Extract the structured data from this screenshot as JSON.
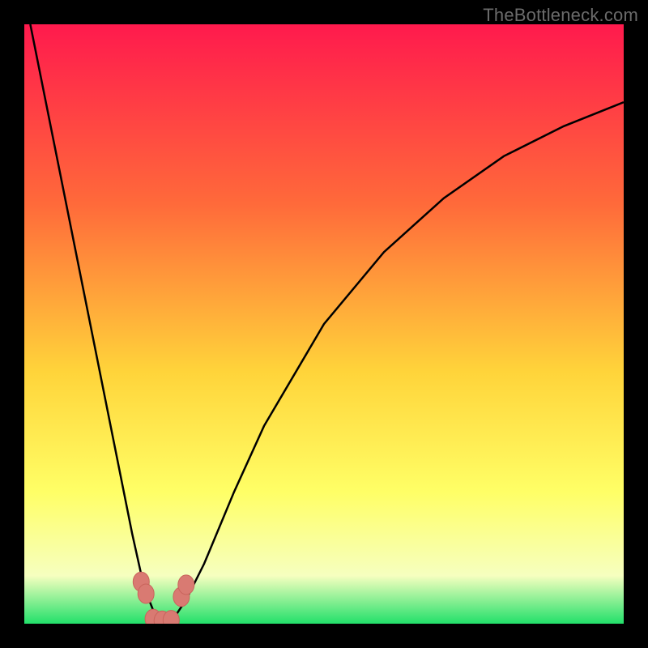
{
  "watermark": "TheBottleneck.com",
  "colors": {
    "frame": "#000000",
    "grad_top": "#ff1a4d",
    "grad_mid1": "#ff6a3a",
    "grad_mid2": "#ffd43a",
    "grad_mid3": "#ffff66",
    "grad_mid4": "#f6ffbf",
    "grad_bottom": "#22e06a",
    "curve": "#000000",
    "marker_fill": "#d97a72",
    "marker_stroke": "#c9645c"
  },
  "chart_data": {
    "type": "line",
    "title": "",
    "xlabel": "",
    "ylabel": "",
    "xlim": [
      0,
      100
    ],
    "ylim": [
      0,
      100
    ],
    "note": "V-shaped bottleneck curve, minimum ~0 near x≈23; watermark TheBottleneck.com",
    "series": [
      {
        "name": "bottleneck-curve",
        "x": [
          1,
          5,
          10,
          15,
          18,
          20,
          22,
          23,
          25,
          27,
          30,
          35,
          40,
          50,
          60,
          70,
          80,
          90,
          100
        ],
        "y": [
          100,
          80,
          55,
          30,
          15,
          6,
          1,
          0,
          1,
          4,
          10,
          22,
          33,
          50,
          62,
          71,
          78,
          83,
          87
        ]
      }
    ],
    "markers": [
      {
        "x": 19.5,
        "y": 7
      },
      {
        "x": 20.3,
        "y": 5
      },
      {
        "x": 21.5,
        "y": 0.8
      },
      {
        "x": 23.0,
        "y": 0.5
      },
      {
        "x": 24.5,
        "y": 0.6
      },
      {
        "x": 26.2,
        "y": 4.5
      },
      {
        "x": 27.0,
        "y": 6.5
      }
    ]
  }
}
